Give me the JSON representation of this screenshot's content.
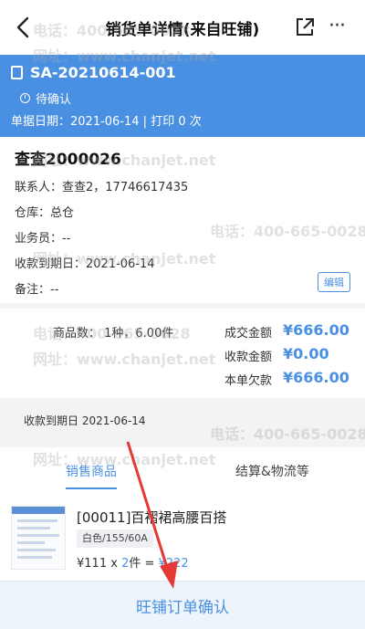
{
  "navbar": {
    "title": "销货单详情(来自旺铺)",
    "back_icon": "chevron-left-icon",
    "share_icon": "share-icon",
    "more_label": "···"
  },
  "header": {
    "order_no": "SA-20210614-001",
    "status": "待确认",
    "date_line": "单据日期：2021-06-14 | 打印 0 次",
    "bg_color": "#4a90e2"
  },
  "info": {
    "customer": "查查2000026",
    "contact": "联系人：查查2，17746617435",
    "warehouse": "仓库：总仓",
    "salesperson": "业务员：--",
    "due_date": "收款到期日：2021-06-14",
    "remark": "备注：--",
    "edit_label": "编辑"
  },
  "summary": {
    "goods_count": "商品数：  1种，6.00件",
    "deal_label": "成交金额",
    "deal_value": "¥666.00",
    "received_label": "收款金额",
    "received_value": "¥0.00",
    "owed_label": "本单欠款",
    "owed_value": "¥666.00"
  },
  "due_strip": {
    "text": "收款到期日  2021-06-14"
  },
  "tabs": {
    "active": "销售商品",
    "other": "结算&物流等"
  },
  "product": {
    "name": "[00011]百褶裙高腰百搭",
    "spec": "白色/155/60A",
    "unit_price": "¥111",
    "times": " x ",
    "qty": "2",
    "qty_unit": "件 = ",
    "total": "¥222"
  },
  "bottom": {
    "confirm_label": "旺铺订单确认"
  },
  "watermarks": {
    "phone": "电话：400-665-0028",
    "site": "网址：www.chanjet.net"
  },
  "colors": {
    "accent": "#4a90e2",
    "annotation": "#e53935"
  }
}
